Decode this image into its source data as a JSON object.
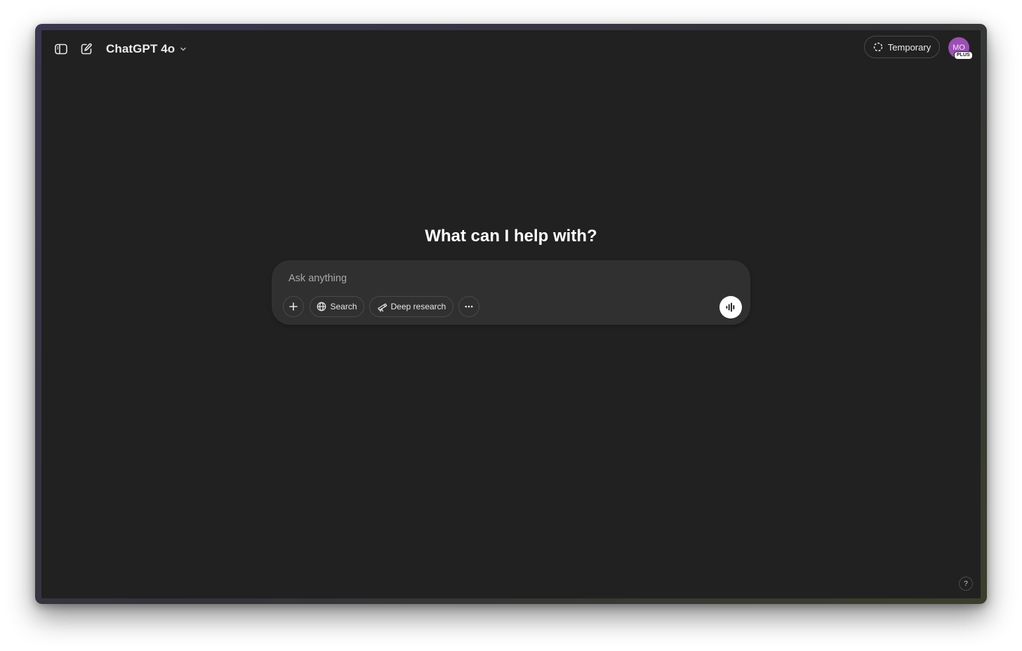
{
  "header": {
    "model_name": "ChatGPT 4o",
    "temporary_label": "Temporary",
    "avatar_initials": "MO",
    "plan_badge": "PLUS"
  },
  "main": {
    "heading": "What can I help with?"
  },
  "composer": {
    "placeholder": "Ask anything",
    "search_label": "Search",
    "deep_research_label": "Deep research"
  },
  "footer": {
    "help_label": "?"
  },
  "icons": {
    "sidebar_toggle": "sidebar-icon",
    "new_chat": "compose-icon",
    "model_dropdown": "chevron-down-icon",
    "temporary": "dashed-circle-icon",
    "attach": "plus-icon",
    "search": "globe-icon",
    "deep_research": "telescope-icon",
    "more": "ellipsis-icon",
    "voice": "voice-waveform-icon"
  },
  "colors": {
    "background": "#212121",
    "composer": "#303030",
    "avatar": "#9b4fb3",
    "text": "#ececec"
  }
}
